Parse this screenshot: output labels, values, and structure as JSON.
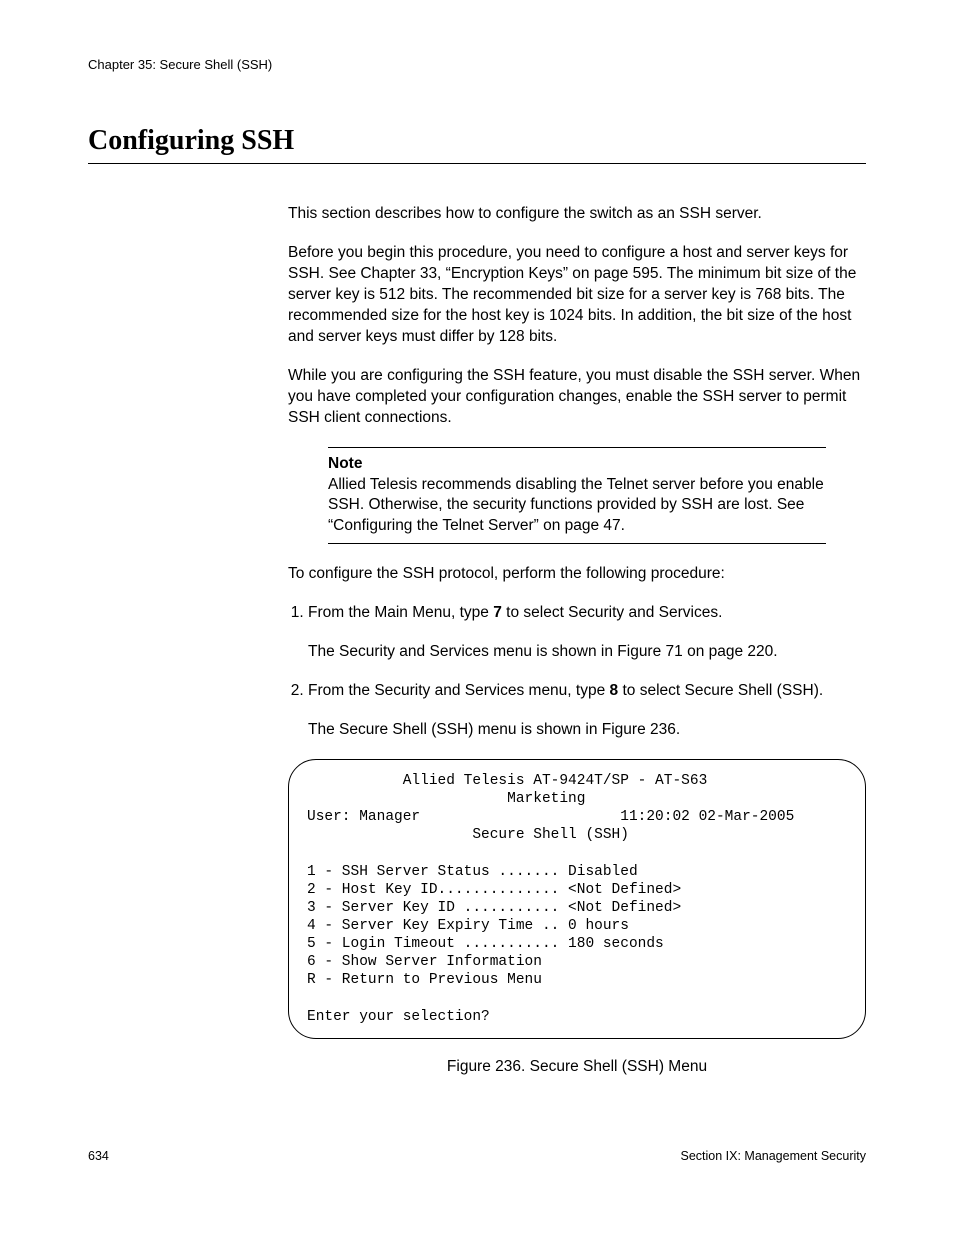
{
  "header": {
    "chapter": "Chapter 35: Secure Shell (SSH)"
  },
  "title": "Configuring SSH",
  "paragraphs": {
    "intro": "This section describes how to configure the switch as an SSH server.",
    "before": "Before you begin this procedure, you need to configure a host and server keys for SSH. See Chapter 33, “Encryption Keys” on page 595. The minimum bit size of the server key is 512 bits. The recommended bit size for a server key is 768 bits. The recommended size for the host key is 1024 bits. In addition, the bit size of the host and server keys must differ by 128 bits.",
    "while": "While you are configuring the SSH feature, you must disable the SSH server. When you have completed your configuration changes, enable the SSH server to permit SSH client connections.",
    "procedure_intro": "To configure the SSH protocol, perform the following procedure:"
  },
  "note": {
    "label": "Note",
    "text": "Allied Telesis recommends disabling the Telnet server before you enable SSH. Otherwise, the security functions provided by SSH are lost. See “Configuring the Telnet Server” on page 47."
  },
  "steps": {
    "s1_pre": "From the Main Menu, type ",
    "s1_bold": "7",
    "s1_post": " to select Security and Services.",
    "s1_follow": "The Security and Services menu is shown in Figure 71 on page 220.",
    "s2_pre": "From the Security and Services menu, type ",
    "s2_bold": "8",
    "s2_post": " to select Secure Shell (SSH).",
    "s2_follow": "The Secure Shell (SSH) menu is shown in Figure 236."
  },
  "menu": {
    "line1": "           Allied Telesis AT-9424T/SP - AT-S63",
    "line2": "                       Marketing",
    "line3": "User: Manager                       11:20:02 02-Mar-2005",
    "line4": "                   Secure Shell (SSH)",
    "line5": "",
    "opt1": "1 - SSH Server Status ....... Disabled",
    "opt2": "2 - Host Key ID.............. <Not Defined>",
    "opt3": "3 - Server Key ID ........... <Not Defined>",
    "opt4": "4 - Server Key Expiry Time .. 0 hours",
    "opt5": "5 - Login Timeout ........... 180 seconds",
    "opt6": "6 - Show Server Information",
    "optR": "R - Return to Previous Menu",
    "blank": "",
    "prompt": "Enter your selection?"
  },
  "figure_caption": "Figure 236. Secure Shell (SSH) Menu",
  "footer": {
    "page": "634",
    "section": "Section IX: Management Security"
  }
}
